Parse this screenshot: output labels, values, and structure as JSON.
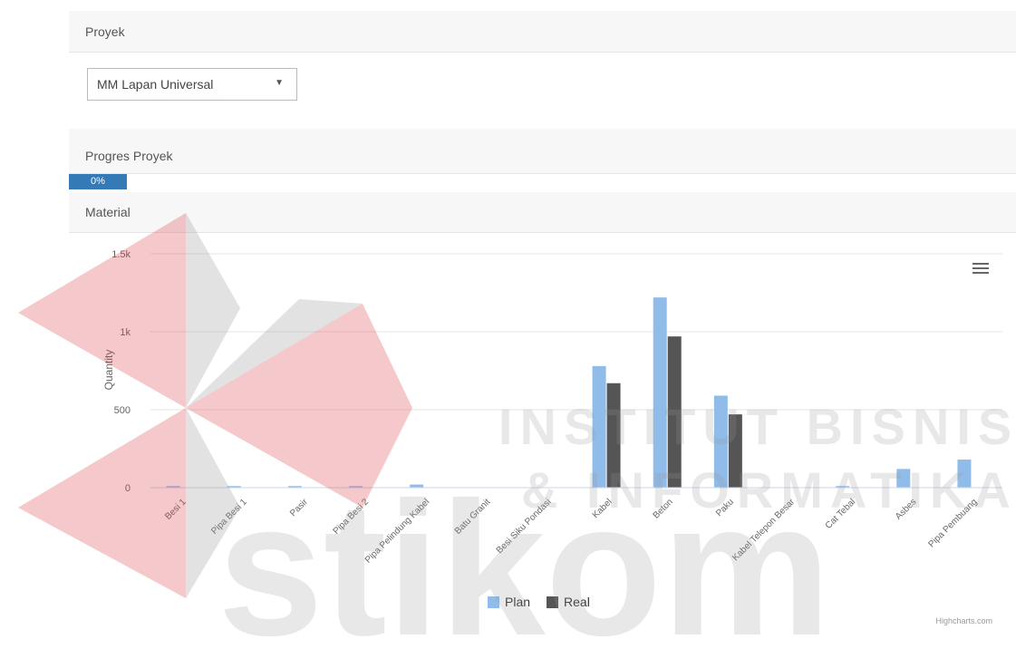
{
  "project_panel": {
    "label": "Proyek"
  },
  "project_select": {
    "value": "MM Lapan Universal"
  },
  "progress_panel": {
    "label": "Progres Proyek"
  },
  "progress": {
    "value_text": "0%",
    "percent": 0
  },
  "material_panel": {
    "label": "Material"
  },
  "chart_data": {
    "type": "bar",
    "title": "",
    "xlabel": "",
    "ylabel": "Quantity",
    "y_ticks": [
      "1.5k",
      "1k",
      "500",
      "0"
    ],
    "ylim": [
      0,
      1500
    ],
    "categories": [
      "Besi 1",
      "Pipa Besi 1",
      "Pasir",
      "Pipa Besi 2",
      "Pipa Pelindung Kabel",
      "Batu Granit",
      "Besi Siku Pondasi",
      "Kabel",
      "Beton",
      "Paku",
      "Kabel Telepon Besar",
      "Cat Tebal",
      "Asbes",
      "Pipa Pembuang"
    ],
    "series": [
      {
        "name": "Plan",
        "color": "#90bce9",
        "values": [
          10,
          10,
          10,
          10,
          20,
          0,
          0,
          780,
          1220,
          590,
          0,
          10,
          120,
          180
        ]
      },
      {
        "name": "Real",
        "color": "#555555",
        "values": [
          0,
          0,
          0,
          0,
          0,
          0,
          0,
          670,
          970,
          470,
          0,
          0,
          0,
          0
        ]
      }
    ],
    "legend_position": "bottom",
    "credits": "Highcharts.com"
  }
}
